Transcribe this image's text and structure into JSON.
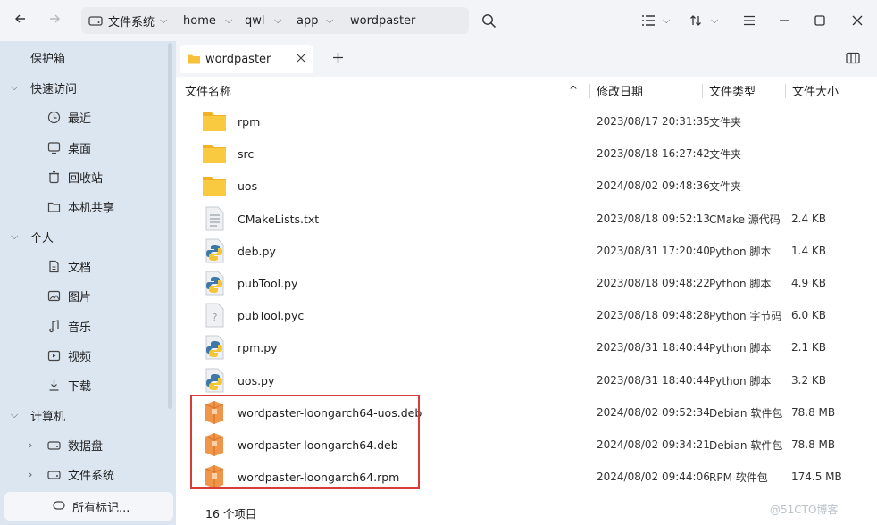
{
  "toolbar": {
    "back_icon": "arrow-left-icon",
    "forward_icon": "arrow-right-icon",
    "breadcrumbs": [
      "文件系统",
      "home",
      "qwl",
      "app",
      "wordpaster"
    ],
    "search_icon": "search-icon",
    "view_icon": "list-view-icon",
    "sort_icon": "sort-icon",
    "menu_icon": "hamburger-menu-icon",
    "window_controls": [
      "minimize-icon",
      "maximize-icon",
      "close-icon"
    ]
  },
  "sidebar": {
    "items": [
      {
        "label": "保护箱",
        "icon": "",
        "level": 0
      },
      {
        "label": "快速访问",
        "icon": "chevron-down-icon",
        "level": 0
      },
      {
        "label": "最近",
        "icon": "clock-icon",
        "level": 1
      },
      {
        "label": "桌面",
        "icon": "desktop-icon",
        "level": 1
      },
      {
        "label": "回收站",
        "icon": "trash-icon",
        "level": 1
      },
      {
        "label": "本机共享",
        "icon": "share-folder-icon",
        "level": 1
      },
      {
        "label": "个人",
        "icon": "chevron-down-icon",
        "level": 0
      },
      {
        "label": "文档",
        "icon": "document-icon",
        "level": 1
      },
      {
        "label": "图片",
        "icon": "image-icon",
        "level": 1
      },
      {
        "label": "音乐",
        "icon": "music-icon",
        "level": 1
      },
      {
        "label": "视频",
        "icon": "video-icon",
        "level": 1
      },
      {
        "label": "下载",
        "icon": "download-icon",
        "level": 1
      },
      {
        "label": "计算机",
        "icon": "chevron-down-icon",
        "level": 0
      },
      {
        "label": "数据盘",
        "icon": "disk-icon",
        "level": 1
      },
      {
        "label": "文件系统",
        "icon": "disk-icon",
        "level": 1
      }
    ],
    "bottom_label": "所有标记..."
  },
  "tab": {
    "label": "wordpaster",
    "add_icon": "plus-icon"
  },
  "columns": [
    "文件名称",
    "修改日期",
    "文件类型",
    "文件大小"
  ],
  "files": [
    {
      "name": "rpm",
      "date": "2023/08/17 20:31:35",
      "type": "文件夹",
      "size": "",
      "icon": "folder"
    },
    {
      "name": "src",
      "date": "2023/08/18 16:27:42",
      "type": "文件夹",
      "size": "",
      "icon": "folder"
    },
    {
      "name": "uos",
      "date": "2024/08/02 09:48:36",
      "type": "文件夹",
      "size": "",
      "icon": "folder"
    },
    {
      "name": "CMakeLists.txt",
      "date": "2023/08/18 09:52:13",
      "type": "CMake 源代码",
      "size": "2.4 KB",
      "icon": "text"
    },
    {
      "name": "deb.py",
      "date": "2023/08/31 17:20:40",
      "type": "Python 脚本",
      "size": "1.4 KB",
      "icon": "python"
    },
    {
      "name": "pubTool.py",
      "date": "2023/08/18 09:48:22",
      "type": "Python 脚本",
      "size": "4.9 KB",
      "icon": "python"
    },
    {
      "name": "pubTool.pyc",
      "date": "2023/08/18 09:48:28",
      "type": "Python 字节码",
      "size": "6.0 KB",
      "icon": "unknown"
    },
    {
      "name": "rpm.py",
      "date": "2023/08/31 18:40:44",
      "type": "Python 脚本",
      "size": "2.1 KB",
      "icon": "python"
    },
    {
      "name": "uos.py",
      "date": "2023/08/31 18:40:44",
      "type": "Python 脚本",
      "size": "3.2 KB",
      "icon": "python"
    },
    {
      "name": "wordpaster-loongarch64-uos.deb",
      "date": "2024/08/02 09:52:34",
      "type": "Debian 软件包",
      "size": "78.8 MB",
      "icon": "package"
    },
    {
      "name": "wordpaster-loongarch64.deb",
      "date": "2024/08/02 09:34:21",
      "type": "Debian 软件包",
      "size": "78.8 MB",
      "icon": "package"
    },
    {
      "name": "wordpaster-loongarch64.rpm",
      "date": "2024/08/02 09:44:06",
      "type": "RPM 软件包",
      "size": "174.5 MB",
      "icon": "package"
    }
  ],
  "status": {
    "count_label": "16 个项目"
  },
  "watermark": "@51CTO博客",
  "colors": {
    "sidebar_bg": "#dce6f0",
    "highlight": "#d93b3b",
    "folder": "#f7c23a",
    "package": "#f0964a"
  }
}
